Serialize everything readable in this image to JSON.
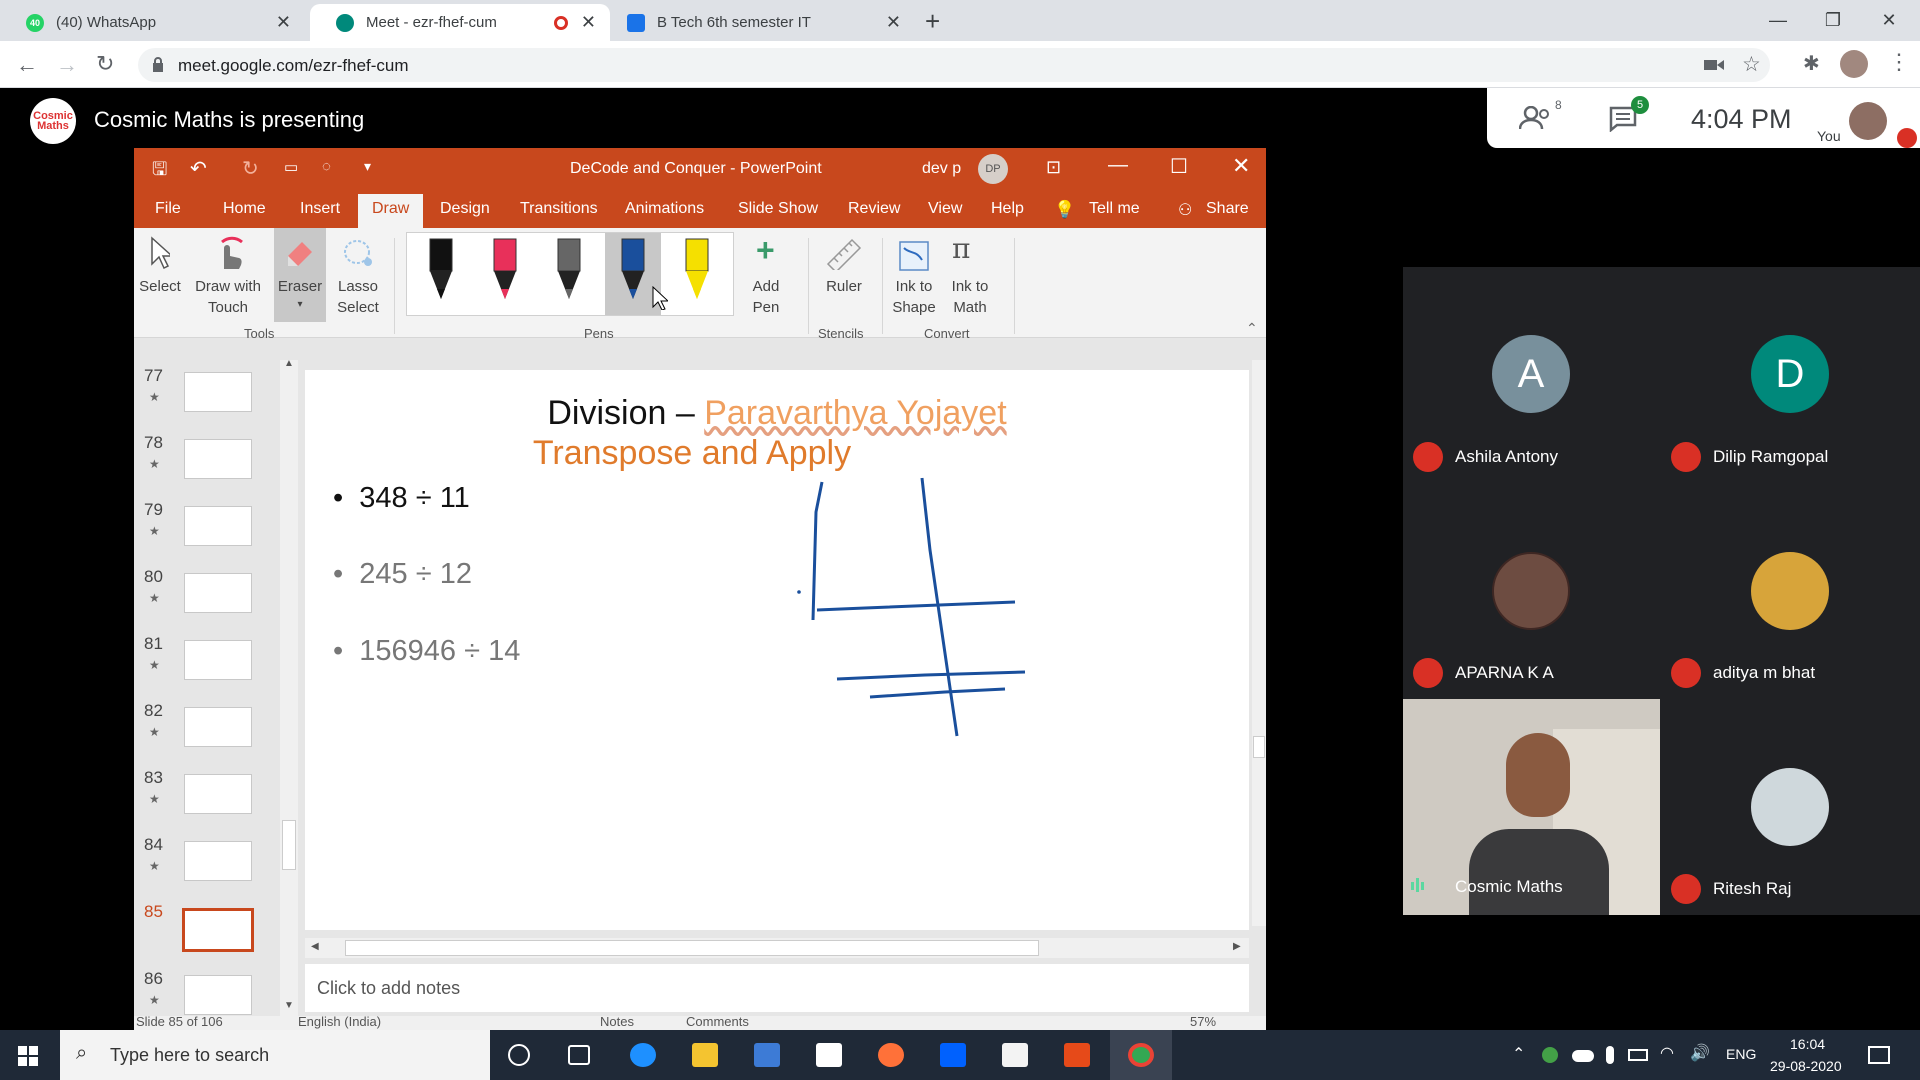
{
  "browser": {
    "tabs": [
      {
        "title": "(40) WhatsApp",
        "badge": "40"
      },
      {
        "title": "Meet - ezr-fhef-cum"
      },
      {
        "title": "B Tech 6th semester IT"
      }
    ],
    "url": "meet.google.com/ezr-fhef-cum"
  },
  "meet": {
    "presenting_text": "Cosmic Maths is presenting",
    "logo_text": "Cosmic Maths",
    "participants_count": "8",
    "chat_count": "5",
    "time": "4:04 PM",
    "you_label": "You",
    "participants": [
      {
        "name": "Ashila Antony",
        "initial": "A",
        "color": "#78909c"
      },
      {
        "name": "Dilip Ramgopal",
        "initial": "D",
        "color": "#00897b"
      },
      {
        "name": "APARNA K A"
      },
      {
        "name": "aditya m bhat"
      },
      {
        "name": "Cosmic Maths"
      },
      {
        "name": "Ritesh Raj"
      }
    ]
  },
  "ppt": {
    "title": "DeCode and Conquer  -  PowerPoint",
    "user": "dev p",
    "user_initials": "DP",
    "tabs": [
      "File",
      "Home",
      "Insert",
      "Draw",
      "Design",
      "Transitions",
      "Animations",
      "Slide Show",
      "Review",
      "View",
      "Help"
    ],
    "tell_me": "Tell me",
    "share": "Share",
    "tools": {
      "select": "Select",
      "draw_touch_1": "Draw with",
      "draw_touch_2": "Touch",
      "eraser": "Eraser",
      "lasso_1": "Lasso",
      "lasso_2": "Select",
      "add_pen_1": "Add",
      "add_pen_2": "Pen",
      "ruler": "Ruler",
      "ink_shape_1": "Ink to",
      "ink_shape_2": "Shape",
      "ink_math_1": "Ink to",
      "ink_math_2": "Math"
    },
    "groups": {
      "tools": "Tools",
      "pens": "Pens",
      "stencils": "Stencils",
      "convert": "Convert"
    },
    "pen_colors": [
      "#111111",
      "#e8305a",
      "#666666",
      "#1a4f9c",
      "#f5e000"
    ],
    "slides": [
      "77",
      "78",
      "79",
      "80",
      "81",
      "82",
      "83",
      "84",
      "85",
      "86"
    ],
    "active_slide": "85",
    "slide": {
      "title_part1": "Division – ",
      "title_part2": "Paravarthya Yojayet",
      "subtitle": "Transpose and Apply",
      "bullets": [
        "348 ÷ 11",
        "245 ÷ 12",
        "156946 ÷ 14"
      ]
    },
    "notes_placeholder": "Click to add notes",
    "status": {
      "slide_count": "Slide 85 of 106",
      "language": "English (India)",
      "notes": "Notes",
      "comments": "Comments",
      "zoom": "57%"
    }
  },
  "taskbar": {
    "search_placeholder": "Type here to search",
    "lang": "ENG",
    "time": "16:04",
    "date": "29-08-2020"
  }
}
